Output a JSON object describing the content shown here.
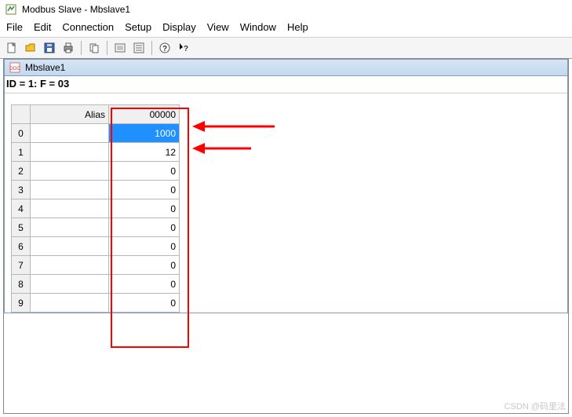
{
  "window": {
    "title": "Modbus Slave - Mbslave1"
  },
  "menus": [
    "File",
    "Edit",
    "Connection",
    "Setup",
    "Display",
    "View",
    "Window",
    "Help"
  ],
  "toolbar_icons": [
    "new",
    "open",
    "save",
    "print",
    "copy",
    "connect",
    "settings-list",
    "help-about",
    "help-context"
  ],
  "document": {
    "title": "Mbslave1",
    "status": "ID = 1: F = 03",
    "columns": {
      "alias": "Alias",
      "reg": "00000"
    },
    "rows": [
      {
        "idx": "0",
        "alias": "",
        "value": "1000",
        "selected": true
      },
      {
        "idx": "1",
        "alias": "",
        "value": "12"
      },
      {
        "idx": "2",
        "alias": "",
        "value": "0"
      },
      {
        "idx": "3",
        "alias": "",
        "value": "0"
      },
      {
        "idx": "4",
        "alias": "",
        "value": "0"
      },
      {
        "idx": "5",
        "alias": "",
        "value": "0"
      },
      {
        "idx": "6",
        "alias": "",
        "value": "0"
      },
      {
        "idx": "7",
        "alias": "",
        "value": "0"
      },
      {
        "idx": "8",
        "alias": "",
        "value": "0"
      },
      {
        "idx": "9",
        "alias": "",
        "value": "0"
      }
    ]
  },
  "watermark": "CSDN @码里法"
}
